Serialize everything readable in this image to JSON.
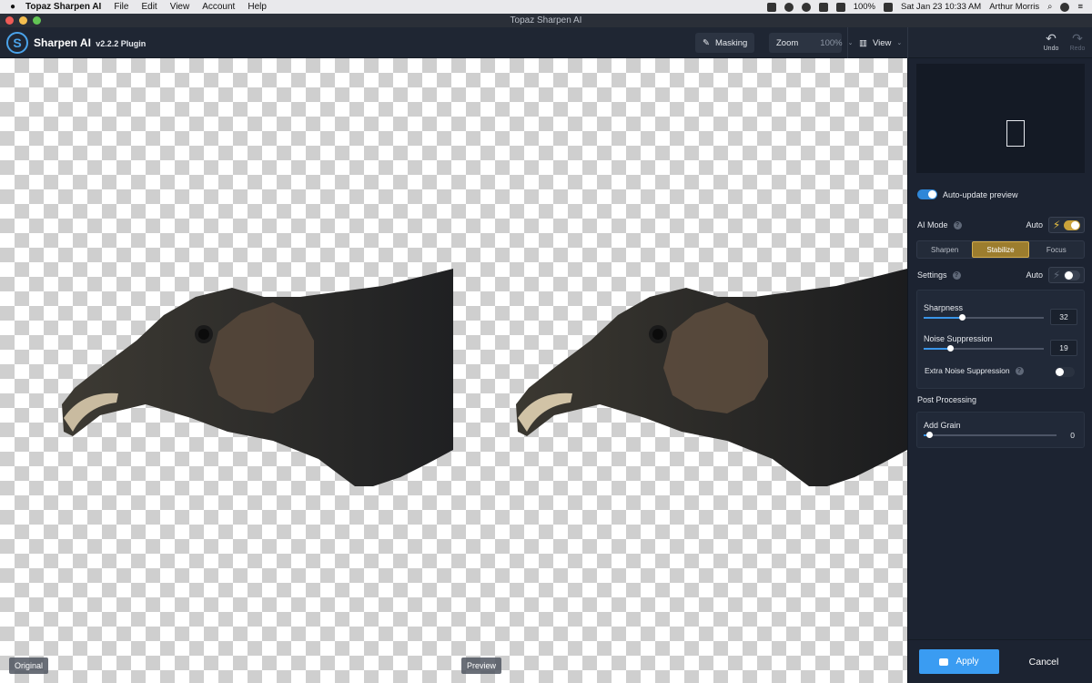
{
  "menubar": {
    "app_name": "Topaz Sharpen AI",
    "menus": [
      "File",
      "Edit",
      "View",
      "Account",
      "Help"
    ],
    "battery": "100%",
    "datetime": "Sat Jan 23  10:33 AM",
    "user": "Arthur Morris"
  },
  "window": {
    "title": "Topaz Sharpen AI"
  },
  "toolbar": {
    "brand": "Sharpen AI",
    "version": "v2.2.2 Plugin",
    "masking_label": "Masking",
    "zoom_label": "Zoom",
    "zoom_value": "100%",
    "view_label": "View",
    "undo_label": "Undo",
    "redo_label": "Redo"
  },
  "canvas": {
    "original_label": "Original",
    "preview_label": "Preview"
  },
  "panel": {
    "auto_update_label": "Auto-update preview",
    "ai_mode_label": "AI Mode",
    "auto_label": "Auto",
    "modes": [
      "Sharpen",
      "Stabilize",
      "Focus"
    ],
    "active_mode": "Stabilize",
    "settings_label": "Settings",
    "settings_auto_label": "Auto",
    "sharpness_label": "Sharpness",
    "sharpness_value": "32",
    "noise_label": "Noise Suppression",
    "noise_value": "19",
    "extra_noise_label": "Extra Noise Suppression",
    "post_processing_label": "Post Processing",
    "grain_label": "Add Grain",
    "grain_value": "0",
    "apply_label": "Apply",
    "cancel_label": "Cancel"
  },
  "colors": {
    "accent": "#3a9cf2",
    "mode_active": "#9c7d2e",
    "bolt": "#e7c042"
  }
}
